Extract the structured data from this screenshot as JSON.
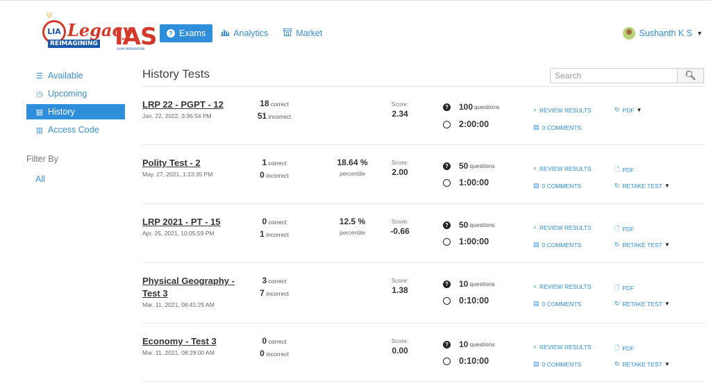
{
  "brand": {
    "badge": "LIA",
    "name_script": "Legacy",
    "name_bold": "IAS",
    "tagline": "REIMAGINING",
    "subtag": "EXAM PREPARATION"
  },
  "nav": {
    "items": [
      {
        "label": "Exams",
        "icon": "question-circle-icon",
        "active": true
      },
      {
        "label": "Analytics",
        "icon": "bar-chart-icon",
        "active": false
      },
      {
        "label": "Market",
        "icon": "store-icon",
        "active": false
      }
    ]
  },
  "user": {
    "name": "Sushanth K S"
  },
  "sidebar": {
    "items": [
      {
        "label": "Available",
        "icon": "list-icon",
        "active": false
      },
      {
        "label": "Upcoming",
        "icon": "clock-icon",
        "active": false
      },
      {
        "label": "History",
        "icon": "archive-icon",
        "active": true
      },
      {
        "label": "Access Code",
        "icon": "barcode-icon",
        "active": false
      }
    ],
    "filter_title": "Filter By",
    "filter_all": "All"
  },
  "page": {
    "title": "History Tests",
    "search_placeholder": "Search"
  },
  "labels": {
    "correct": "correct",
    "incorrect": "incorrect",
    "score": "Score:",
    "percentile": "percentile",
    "questions": "questions",
    "review": "REVIEW RESULTS",
    "comments": "0 COMMENTS",
    "pdf": "PDF",
    "retake": "RETAKE TEST"
  },
  "tests": [
    {
      "name": "LRP 22 - PGPT - 12",
      "date": "Jan. 22, 2022, 3:36:54 PM",
      "correct": "18",
      "incorrect": "51",
      "percent": "",
      "score": "2.34",
      "questions": "100",
      "time": "2:00:00",
      "retake": false
    },
    {
      "name": "Polity Test - 2",
      "date": "May. 27, 2021, 1:23:35 PM",
      "correct": "1",
      "incorrect": "0",
      "percent": "18.64 %",
      "score": "2.00",
      "questions": "50",
      "time": "1:00:00",
      "retake": true
    },
    {
      "name": "LRP 2021 - PT - 15",
      "date": "Apr. 25, 2021, 10:05:59 PM",
      "correct": "0",
      "incorrect": "1",
      "percent": "12.5 %",
      "score": "-0.66",
      "questions": "50",
      "time": "1:00:00",
      "retake": true
    },
    {
      "name": "Physical Geography - Test 3",
      "date": "Mar. 11, 2021, 08:41:25 AM",
      "correct": "3",
      "incorrect": "7",
      "percent": "",
      "score": "1.38",
      "questions": "10",
      "time": "0:10:00",
      "retake": true
    },
    {
      "name": "Economy - Test 3",
      "date": "Mar. 11, 2021, 08:29:00 AM",
      "correct": "0",
      "incorrect": "0",
      "percent": "",
      "score": "0.00",
      "questions": "10",
      "time": "0:10:00",
      "retake": true
    }
  ]
}
